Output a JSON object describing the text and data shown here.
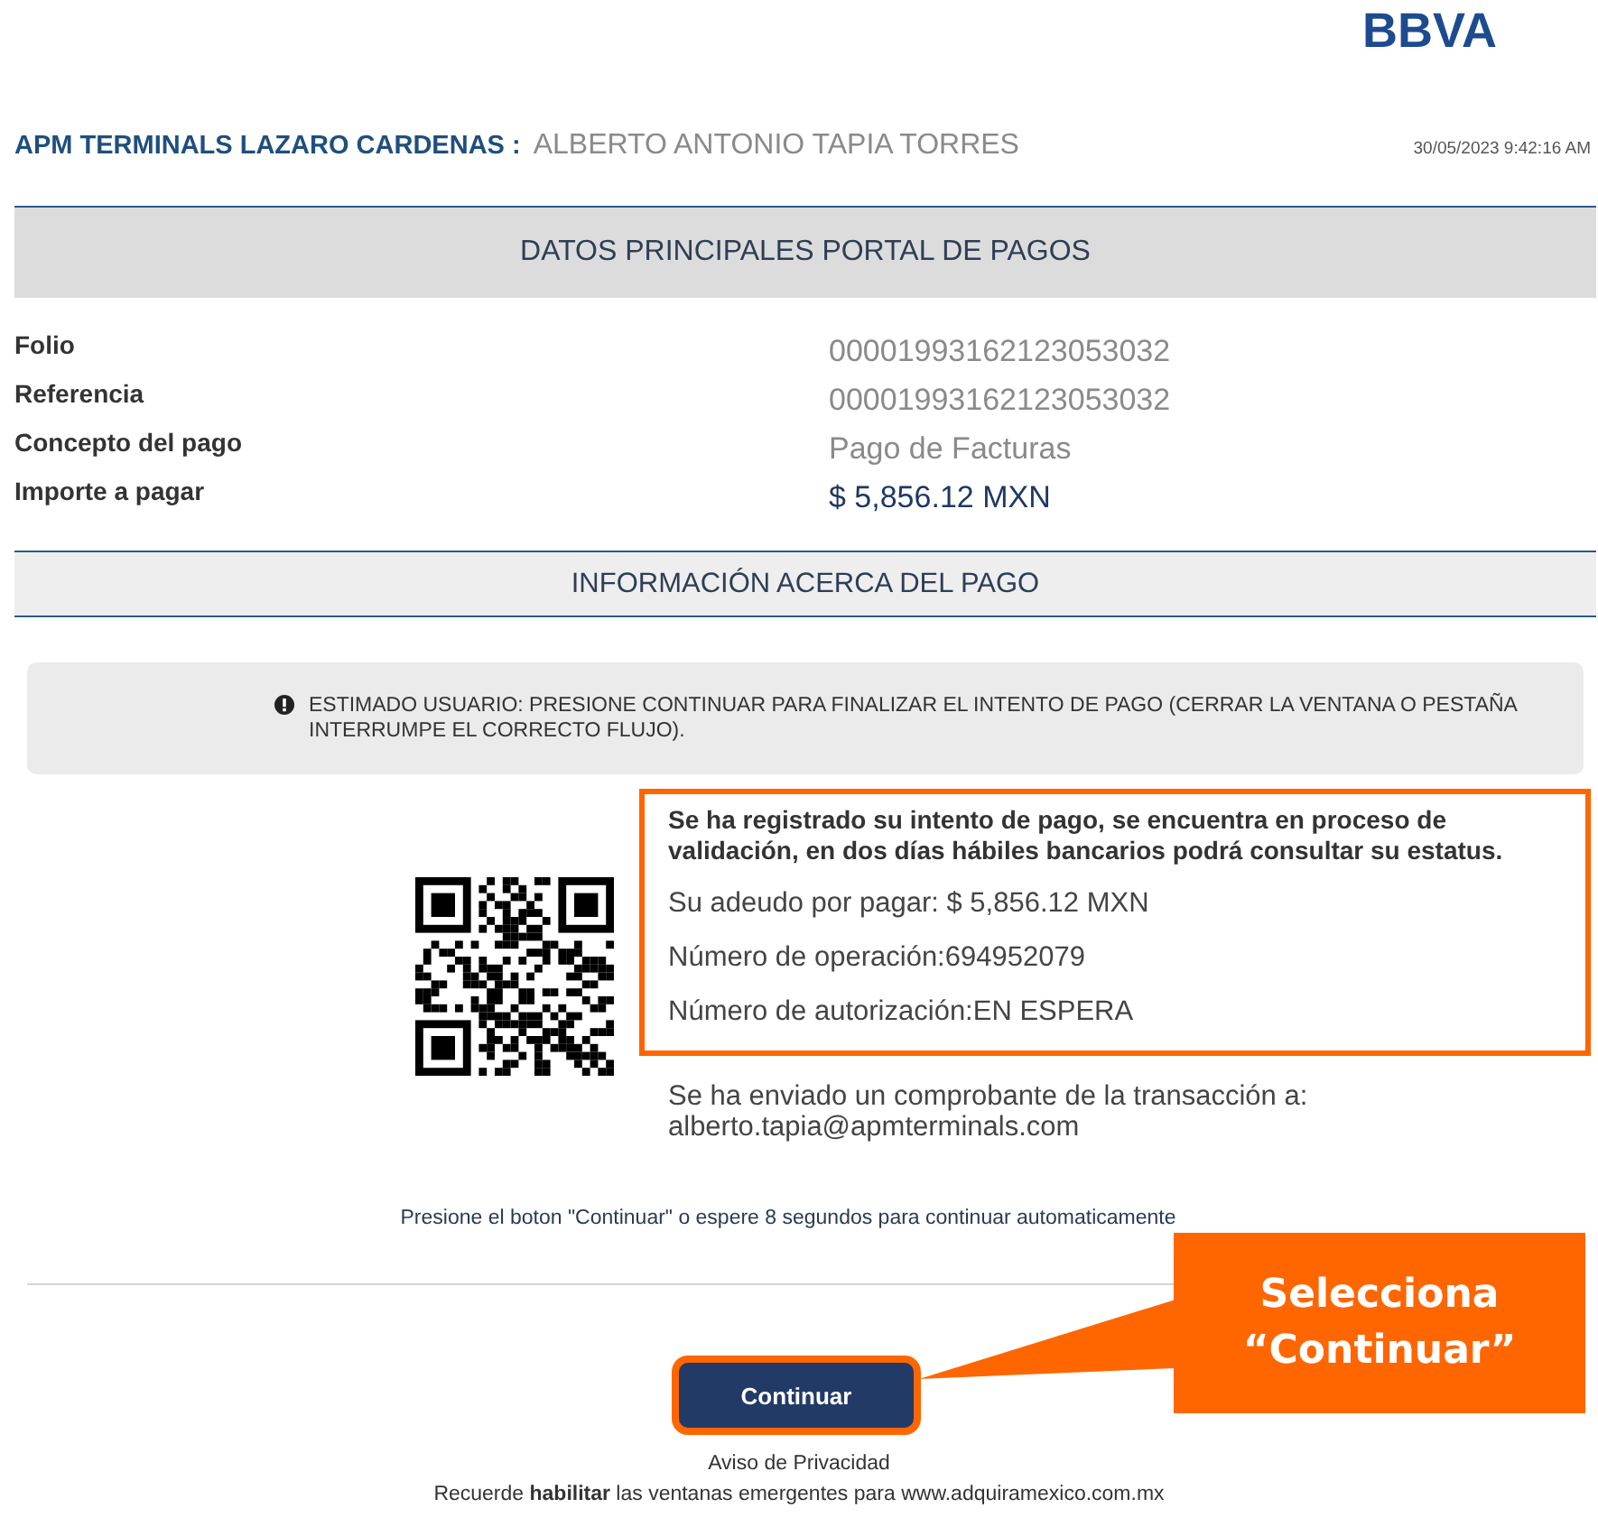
{
  "logo": {
    "text": "BBVA"
  },
  "header": {
    "company": "APM TERMINALS LAZARO CARDENAS :",
    "customer": "ALBERTO ANTONIO TAPIA TORRES",
    "timestamp": "30/05/2023 9:42:16 AM"
  },
  "main_section": {
    "title": "DATOS PRINCIPALES PORTAL DE PAGOS",
    "fields": [
      {
        "label": "Folio",
        "value": "00001993162123053032",
        "kind": "plain"
      },
      {
        "label": "Referencia",
        "value": "00001993162123053032",
        "kind": "plain"
      },
      {
        "label": "Concepto del pago",
        "value": "Pago de Facturas",
        "kind": "plain"
      },
      {
        "label": "Importe a pagar",
        "value": "$ 5,856.12 MXN",
        "kind": "amount"
      }
    ]
  },
  "info_section": {
    "title": "INFORMACIÓN ACERCA DEL PAGO",
    "notice": "ESTIMADO USUARIO: PRESIONE CONTINUAR PARA FINALIZAR EL INTENTO DE PAGO (CERRAR LA VENTANA O PESTAÑA INTERRUMPE EL CORRECTO FLUJO)."
  },
  "result": {
    "headline": "Se ha registrado su intento de pago, se encuentra en proceso de validación, en dos días hábiles bancarios podrá consultar su estatus.",
    "lines": [
      "Su adeudo por pagar: $ 5,856.12 MXN",
      "Número de operación:694952079",
      "Número de autorización:EN ESPERA"
    ],
    "receipt_note": "Se ha enviado un comprobante de la transacción a:",
    "email": "alberto.tapia@apmterminals.com"
  },
  "auto_continue": "Presione el boton \"Continuar\" o espere 8 segundos para continuar automaticamente",
  "continue_button": "Continuar",
  "footer": {
    "privacy": "Aviso de Privacidad",
    "popup_note": "Recuerde **habilitar** las ventanas emergentes para www.adquiramexico.com.mx"
  },
  "callout": {
    "text": "Selecciona “Continuar”"
  }
}
